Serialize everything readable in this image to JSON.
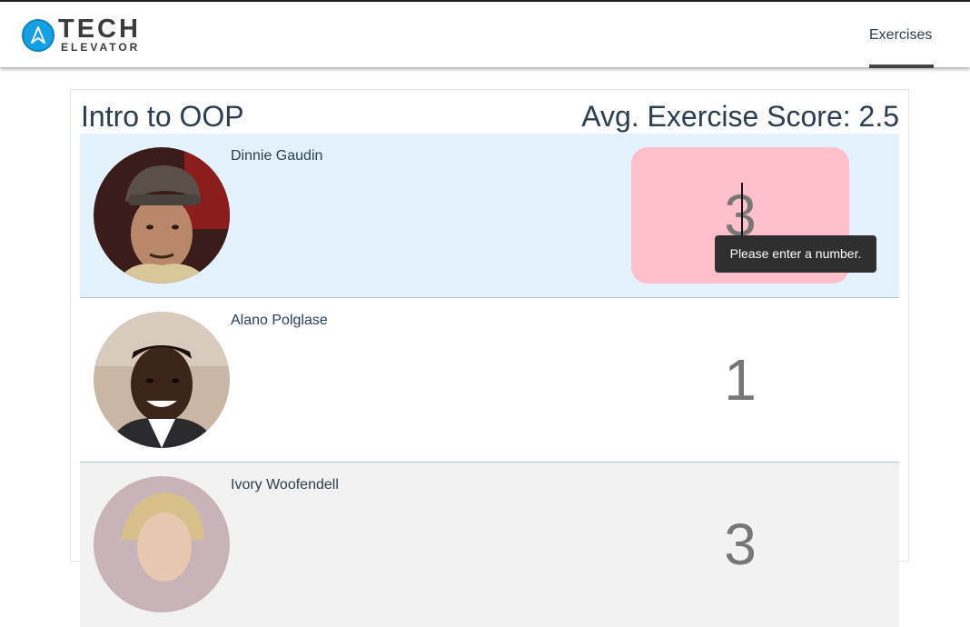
{
  "header": {
    "logo_top": "TECH",
    "logo_bottom": "ELEVATOR",
    "nav_exercises": "Exercises"
  },
  "page": {
    "title": "Intro to OOP",
    "avg_label": "Avg. Exercise Score: 2.5"
  },
  "students": [
    {
      "name": "Dinnie Gaudin",
      "score": "3",
      "invalid": true
    },
    {
      "name": "Alano Polglase",
      "score": "1"
    },
    {
      "name": "Ivory Woofendell",
      "score": "3"
    }
  ],
  "tooltip": {
    "text": "Please enter a number."
  },
  "colors": {
    "accent": "#14a0e4",
    "invalid_bg": "#ffc0cb",
    "row_highlight": "#e3f2fd"
  }
}
